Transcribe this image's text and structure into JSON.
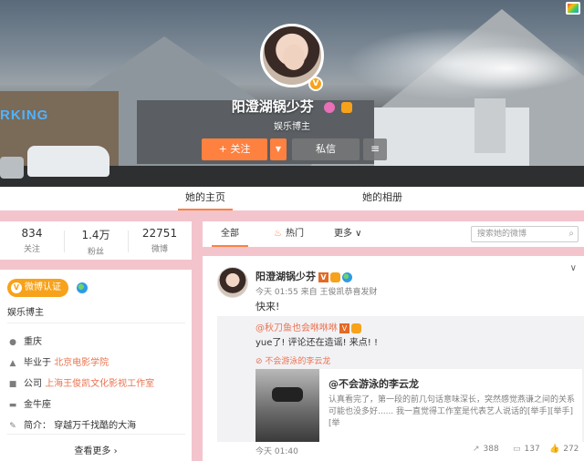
{
  "header": {
    "banner_text": "RKING",
    "name": "阳澄湖锅少芬",
    "subtitle": "娱乐博主",
    "follow_label": "+ 关注",
    "dropdown_label": "▼",
    "message_label": "私信",
    "menu_label": "≡"
  },
  "tabs": [
    {
      "label": "她的主页"
    },
    {
      "label": "她的相册"
    }
  ],
  "stats": [
    {
      "value": "834",
      "label": "关注"
    },
    {
      "value": "1.4万",
      "label": "粉丝"
    },
    {
      "value": "22751",
      "label": "微博"
    }
  ],
  "info": {
    "verified_label": "微博认证",
    "role": "娱乐博主",
    "location": "重庆",
    "school_prefix": "毕业于 ",
    "school": "北京电影学院",
    "company_prefix": "公司 ",
    "company": "上海王俊凯文化影视工作室",
    "zodiac": "金牛座",
    "bio": "简介： 穿越万千找酷的大海",
    "more_label": "查看更多 ›"
  },
  "feed": {
    "tab_all": "全部",
    "tab_hot": "热门",
    "tab_more": "更多 ∨",
    "search_placeholder": "搜索她的微博"
  },
  "post": {
    "author": "阳澄湖锅少芬",
    "meta": "今天 01:55 来自 王俊凯恭喜发财",
    "text": "快来!",
    "repost_author": "@秋刀鱼也会咻咻咻",
    "repost_text": "yue了! 评论还在造谣! 来点! !",
    "repost_link": "不会游泳的李云龙",
    "card_title": "@不会游泳的李云龙",
    "card_desc": "认真看完了，第一段的前几句话意味深长，突然感觉燕谦之间的关系可能也没多好...... 我一直觉得工作室是代表艺人说话的[举手][举手][举",
    "time": "今天 01:40",
    "reposts": "388",
    "comments": "137",
    "likes": "272"
  }
}
